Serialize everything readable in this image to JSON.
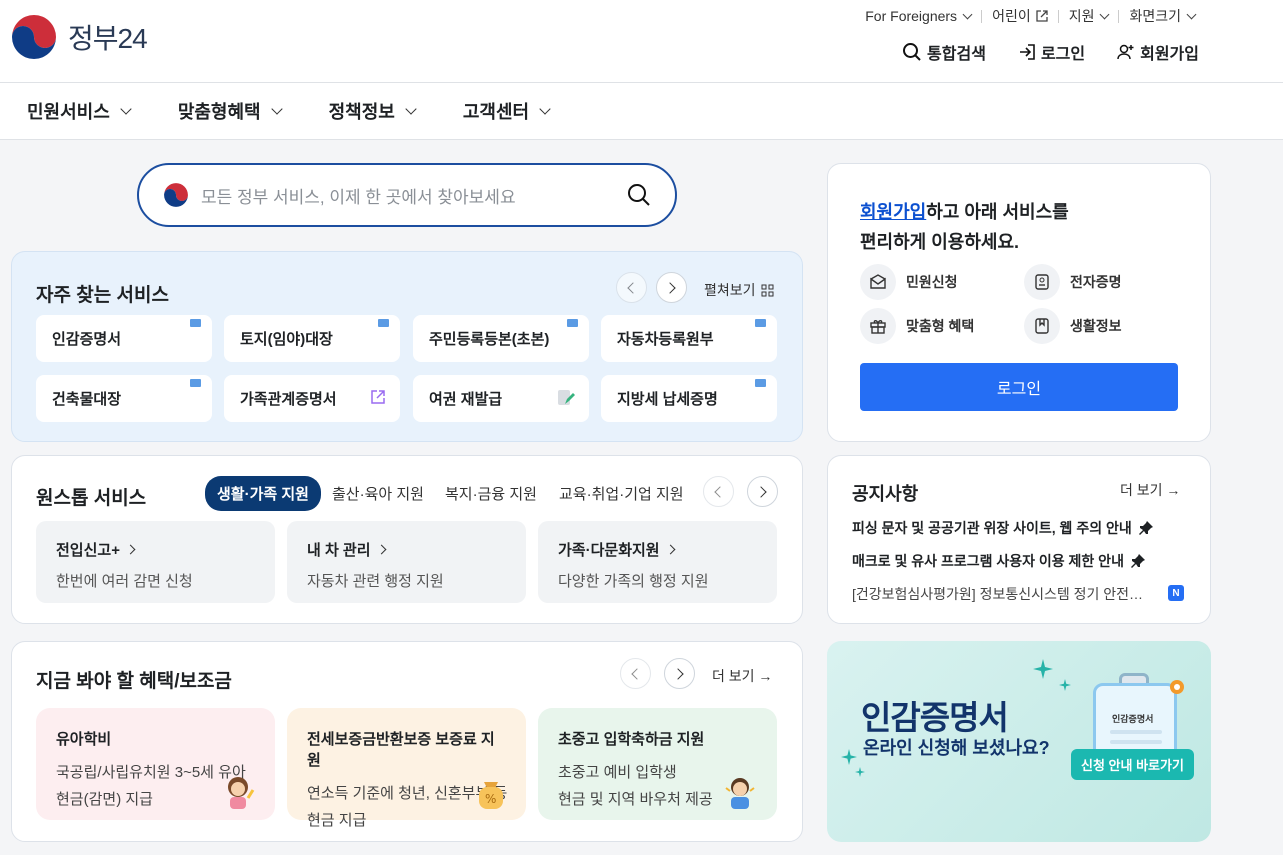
{
  "header": {
    "logo_text": "정부24",
    "util": [
      "For Foreigners",
      "어린이",
      "지원",
      "화면크기"
    ],
    "actions": [
      "통합검색",
      "로그인",
      "회원가입"
    ]
  },
  "gnb": [
    "민원서비스",
    "맞춤형혜택",
    "정책정보",
    "고객센터"
  ],
  "search": {
    "placeholder": "모든 정부 서비스, 이제 한 곳에서 찾아보세요"
  },
  "frequent": {
    "title": "자주 찾는 서비스",
    "spread": "펼쳐보기",
    "items": [
      "인감증명서",
      "토지(임야)대장",
      "주민등록등본(초본)",
      "자동차등록원부",
      "건축물대장",
      "가족관계증명서",
      "여권 재발급",
      "지방세 납세증명"
    ]
  },
  "onestop": {
    "title": "원스톱 서비스",
    "tabs": [
      "생활·가족 지원",
      "출산·육아 지원",
      "복지·금융 지원",
      "교육·취업·기업 지원"
    ],
    "cards": [
      {
        "title": "전입신고+",
        "desc": "한번에 여러 감면 신청"
      },
      {
        "title": "내 차 관리",
        "desc": "자동차 관련 행정 지원"
      },
      {
        "title": "가족·다문화지원",
        "desc": "다양한 가족의 행정 지원"
      }
    ]
  },
  "benefits": {
    "title": "지금 봐야 할 혜택/보조금",
    "more": "더 보기",
    "cards": [
      {
        "title": "유아학비",
        "lines": [
          "국공립/사립유치원 3~5세 유아",
          "현금(감면) 지급"
        ]
      },
      {
        "title": "전세보증금반환보증 보증료 지원",
        "lines": [
          "연소득 기준에 청년, 신혼부부 등",
          "현금 지급"
        ]
      },
      {
        "title": "초중고 입학축하금 지원",
        "lines": [
          "초중고 예비 입학생",
          "현금 및 지역 바우처 제공"
        ]
      }
    ]
  },
  "login_card": {
    "highlight": "회원가입",
    "line1_rest": "하고 아래 서비스를",
    "line2": "편리하게 이용하세요.",
    "services": [
      "민원신청",
      "전자증명",
      "맞춤형 혜택",
      "생활정보"
    ],
    "button": "로그인"
  },
  "notice": {
    "title": "공지사항",
    "more": "더 보기",
    "items": [
      "피싱 문자 및 공공기관 위장 사이트, 웹 주의 안내",
      "매크로 및 유사 프로그램 사용자 이용 제한 안내",
      "[건강보험심사평가원] 정보통신시스템 정기 안전…"
    ],
    "new_badge": "N"
  },
  "banner": {
    "title": "인감증명서",
    "subtitle": "온라인 신청해 보셨나요?",
    "button": "신청 안내 바로가기",
    "clip_label": "인감증명서"
  }
}
